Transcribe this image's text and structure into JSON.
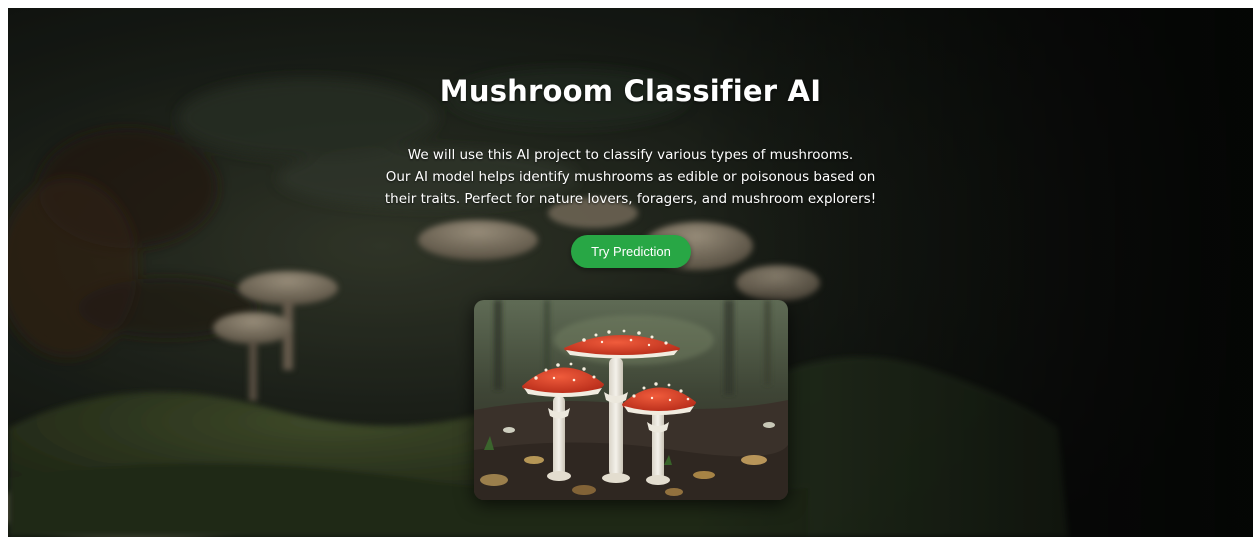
{
  "hero": {
    "title": "Mushroom Classifier AI",
    "description_lines": [
      "We will use this AI project to classify various types of mushrooms.",
      "Our AI model helps identify mushrooms as edible or poisonous based on",
      "their traits. Perfect for nature lovers, foragers, and mushroom explorers!"
    ],
    "cta_label": "Try Prediction",
    "accent_color": "#28a745"
  }
}
